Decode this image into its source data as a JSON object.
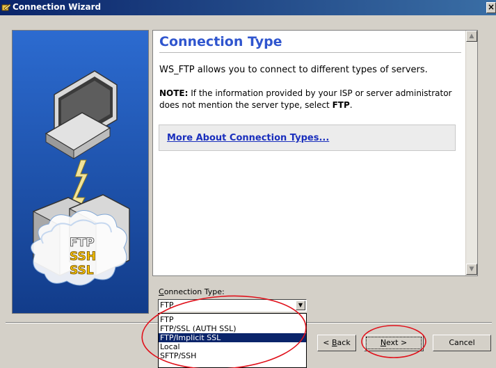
{
  "window": {
    "title": "Connection Wizard",
    "close_glyph": "×"
  },
  "art": {
    "labels": [
      "FTP",
      "SSH",
      "SSL"
    ]
  },
  "content": {
    "heading": "Connection Type",
    "description": "WS_FTP allows you to connect to different types of servers.",
    "note_label": "NOTE:",
    "note_text": " If the information provided by your ISP or server administrator does not mention the server type, select ",
    "note_emph": "FTP",
    "note_end": ".",
    "more_link": "More About Connection Types..."
  },
  "connection_type": {
    "label_accel": "C",
    "label_rest": "onnection Type:",
    "selected": "FTP",
    "options": [
      "FTP",
      "FTP/SSL (AUTH SSL)",
      "FTP/Implicit SSL",
      "Local",
      "SFTP/SSH"
    ],
    "highlighted_index": 2
  },
  "buttons": {
    "back_prefix": "< ",
    "back_accel": "B",
    "back_rest": "ack",
    "next_accel": "N",
    "next_rest": "ext >",
    "cancel": "Cancel"
  },
  "colors": {
    "title_bar": "#0a246a",
    "heading": "#2f55ce",
    "link": "#1a2fbd",
    "selection": "#0a246a",
    "annotation": "#e0101a",
    "art_background": "#1e57b3"
  }
}
